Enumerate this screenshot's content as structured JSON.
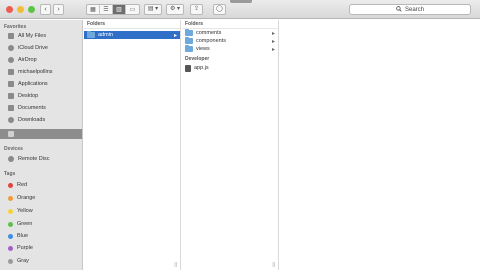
{
  "toolbar": {
    "back": "‹",
    "forward": "›",
    "view_buttons": [
      "▦",
      "☰",
      "▥",
      "▭"
    ],
    "arrange": "▤ ▾",
    "action": "⚙ ▾",
    "share": "⇪",
    "tags": "◯",
    "search_placeholder": "Search",
    "search_icon": "magnifier-icon"
  },
  "sidebar": {
    "favorites_header": "Favorites",
    "favorites": [
      {
        "label": "All My Files",
        "icon": "all-files-icon"
      },
      {
        "label": "iCloud Drive",
        "icon": "cloud-icon"
      },
      {
        "label": "AirDrop",
        "icon": "airdrop-icon"
      },
      {
        "label": "michaelpollins",
        "icon": "home-icon"
      },
      {
        "label": "Applications",
        "icon": "applications-icon"
      },
      {
        "label": "Desktop",
        "icon": "desktop-icon"
      },
      {
        "label": "Documents",
        "icon": "documents-icon"
      },
      {
        "label": "Downloads",
        "icon": "downloads-icon"
      },
      {
        "label": "",
        "icon": "folder-icon",
        "selected": true
      }
    ],
    "devices_header": "Devices",
    "devices": [
      {
        "label": "Remote Disc",
        "icon": "disc-icon"
      }
    ],
    "tags_header": "Tags",
    "tags": [
      {
        "label": "Red",
        "color": "#e0443e"
      },
      {
        "label": "Orange",
        "color": "#f19a37"
      },
      {
        "label": "Yellow",
        "color": "#f3d33c"
      },
      {
        "label": "Green",
        "color": "#5fbf4b"
      },
      {
        "label": "Blue",
        "color": "#3b8ee5"
      },
      {
        "label": "Purple",
        "color": "#a35fc8"
      },
      {
        "label": "Gray",
        "color": "#9a9a9a"
      }
    ]
  },
  "column1": {
    "header": "Folders",
    "items": [
      {
        "label": "admin",
        "type": "folder",
        "selected": true
      }
    ]
  },
  "column2": {
    "header": "Folders",
    "folders": [
      {
        "label": "comments"
      },
      {
        "label": "components"
      },
      {
        "label": "views"
      }
    ],
    "developer_header": "Developer",
    "files": [
      {
        "label": "app.js"
      }
    ]
  },
  "colors": {
    "selection": "#2f6fc7",
    "sidebar_bg": "#e4e4e4"
  }
}
